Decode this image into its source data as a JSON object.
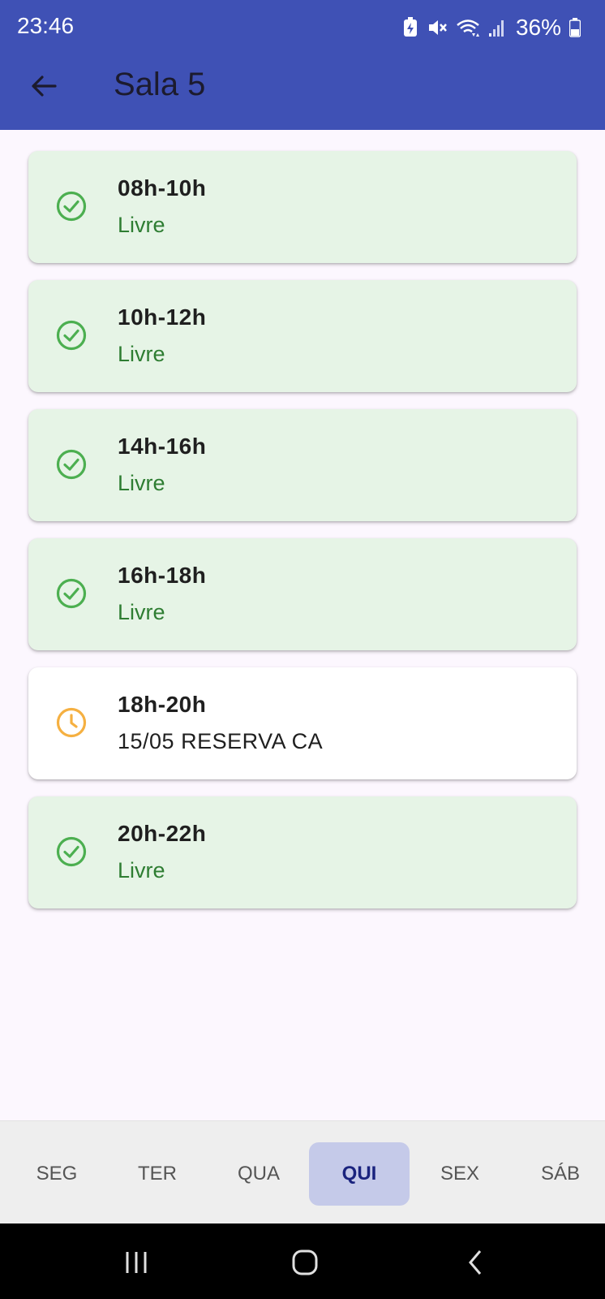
{
  "status_bar": {
    "time": "23:46",
    "battery": "36%",
    "icons": [
      "battery-saver-icon",
      "mute-icon",
      "wifi-icon",
      "signal-icon",
      "battery-icon"
    ]
  },
  "header": {
    "title": "Sala 5",
    "back_icon": "arrow-left-icon"
  },
  "colors": {
    "appbar": "#3F51B5",
    "free_card": "#E6F4E6",
    "free_text": "#2E7D32",
    "free_icon": "#4CAF50",
    "reserved_icon": "#F5B041",
    "active_tab": "#C5CAE9"
  },
  "slots": [
    {
      "time": "08h-10h",
      "status": "Livre",
      "icon": "check-circle-icon"
    },
    {
      "time": "10h-12h",
      "status": "Livre",
      "icon": "check-circle-icon"
    },
    {
      "time": "14h-16h",
      "status": "Livre",
      "icon": "check-circle-icon"
    },
    {
      "time": "16h-18h",
      "status": "Livre",
      "icon": "check-circle-icon"
    },
    {
      "time": "18h-20h",
      "status": "15/05 RESERVA CA",
      "icon": "clock-icon"
    },
    {
      "time": "20h-22h",
      "status": "Livre",
      "icon": "check-circle-icon"
    }
  ],
  "days": [
    {
      "label": "SEG"
    },
    {
      "label": "TER"
    },
    {
      "label": "QUA"
    },
    {
      "label": "QUI"
    },
    {
      "label": "SEX"
    },
    {
      "label": "SÁB"
    }
  ],
  "selected_day": "QUI"
}
